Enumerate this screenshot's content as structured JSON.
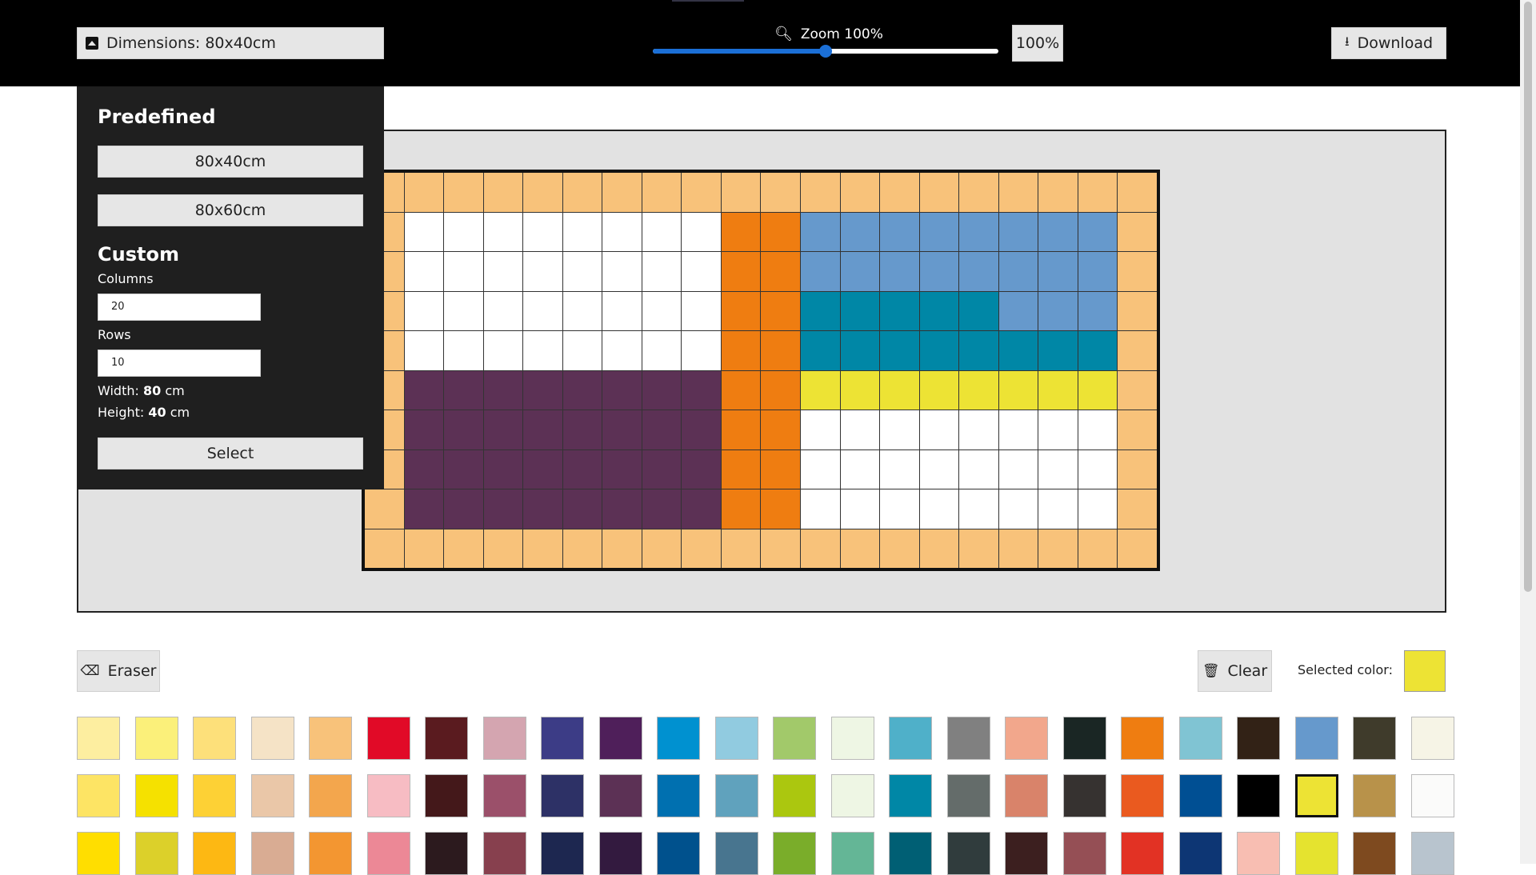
{
  "toolbar": {
    "dimensions_label": "Dimensions: 80x40cm",
    "zoom_label": "Zoom 100%",
    "zoom_value": "100%",
    "zoom_level": 0.5,
    "download_label": "Download"
  },
  "dimension_menu": {
    "predefined_title": "Predefined",
    "presets": [
      "80x40cm",
      "80x60cm"
    ],
    "custom_title": "Custom",
    "columns_label": "Columns",
    "columns_value": "20",
    "rows_label": "Rows",
    "rows_value": "10",
    "width_label": "Width:",
    "width_value": "80",
    "height_label": "Height:",
    "height_value": "40",
    "unit": "cm",
    "select_label": "Select"
  },
  "canvas": {
    "columns": 20,
    "rows": 10,
    "palette": {
      "B": "#f8c27a",
      "W": "#ffffff",
      "O": "#ef7d11",
      "L": "#6699cc",
      "T": "#0087a6",
      "Y": "#ede334",
      "P": "#5c3155"
    },
    "cells": [
      "BBBBBBBBBBBBBBBBBBBB",
      "BWWWWWWWWOOLLLLLLLLB",
      "BWWWWWWWWOOLLLLLLLLB",
      "BWWWWWWWWOOTTTTTLLLB",
      "BWWWWWWWWOOTTTTTTTTB",
      "BPPPPPPPPOOYYYYYYYYB",
      "BPPPPPPPPOOWWWWWWWWB",
      "BPPPPPPPPOOWWWWWWWWB",
      "BPPPPPPPPOOWWWWWWWWB",
      "BBBBBBBBBBBBBBBBBBBB"
    ]
  },
  "tools": {
    "eraser_label": "Eraser",
    "clear_label": "Clear",
    "selected_color_label": "Selected color:",
    "selected_color": "#ede334"
  },
  "palette_colors": [
    [
      "#fdeea0",
      "#fbf07a",
      "#fde07a",
      "#f5e3c6",
      "#f8c27a",
      "#e10a27",
      "#5a1b1f",
      "#d4a5b0",
      "#3c3c86",
      "#4f1f5a",
      "#0091d0",
      "#91cbe0",
      "#a2c96a",
      "#eef6e4",
      "#4fb0c9",
      "#808080",
      "#f2a78c",
      "#1a2624",
      "#ef7d11",
      "#80c4d3",
      "#322216",
      "#6699cc",
      "#3f3b2b",
      "#f6f4e6"
    ],
    [
      "#fde464",
      "#f5e100",
      "#fdd135",
      "#eac7a8",
      "#f3a64d",
      "#f7bcc3",
      "#44181a",
      "#9b506a",
      "#2d3166",
      "#5c3155",
      "#0070b0",
      "#60a2bd",
      "#abc70f",
      "#eef6e4",
      "#0087a6",
      "#646c6a",
      "#d9836a",
      "#363230",
      "#ea5a1f",
      "#004f93",
      "#000000",
      "#ede334",
      "#b8924a",
      "#fbfbfa"
    ],
    [
      "#ffde00",
      "#dcd02a",
      "#fdb813",
      "#d9ac93",
      "#f39631",
      "#ec8896",
      "#2c1a1e",
      "#87404e",
      "#1d2750",
      "#331a3f",
      "#00518d",
      "#48758f",
      "#7aad2a",
      "#64b696",
      "#005f74",
      "#303c3d",
      "#3c1f1f",
      "#954f55",
      "#e23224",
      "#0d3674",
      "#f8beb2",
      "#e5e32f",
      "#7e4a1f",
      "#b8c4ce"
    ]
  ]
}
